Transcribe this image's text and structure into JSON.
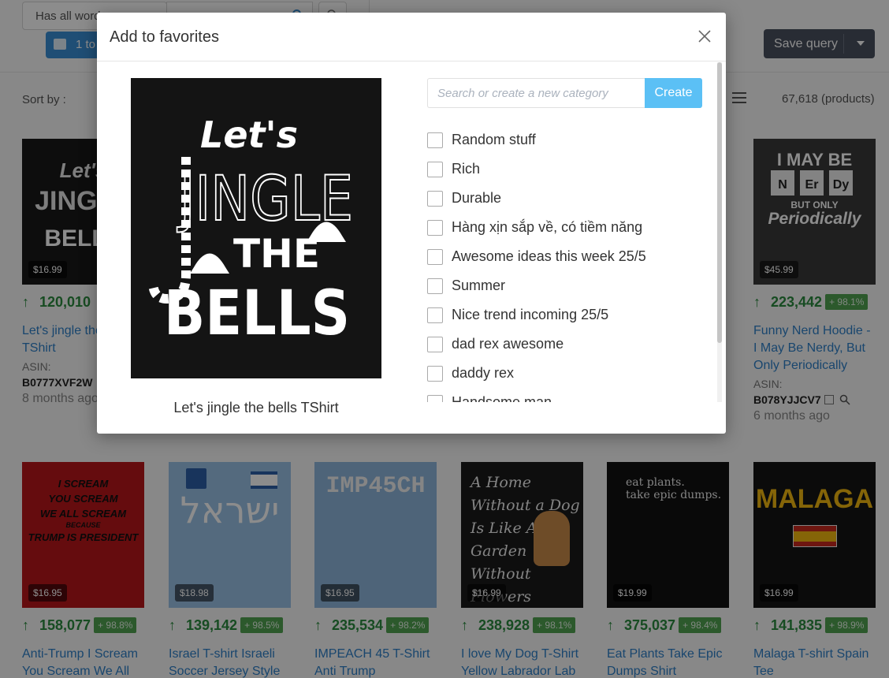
{
  "toolbar": {
    "filter_mode": "Has all words",
    "results_label": "1 to",
    "save_query_label": "Save query"
  },
  "listing": {
    "sort_label": "Sort by :",
    "product_count": "67,618 (products)"
  },
  "products_top": [
    {
      "price": "$16.99",
      "rank": "120,010",
      "title": "Let's jingle the bells TShirt",
      "asin_label": "ASIN:",
      "asin": "B0777XVF2W",
      "age": "8 months ago"
    },
    {
      "price": "$45.99",
      "rank": "223,442",
      "pct": "+ 98.1%",
      "title": "Funny Nerd Hoodie - I May Be Nerdy, But Only Periodically",
      "asin_label": "ASIN:",
      "asin": "B078YJJCV7",
      "age": "6 months ago"
    }
  ],
  "products_bottom": [
    {
      "price": "$16.95",
      "rank": "158,077",
      "pct": "+ 98.8%",
      "title": "Anti-Trump I Scream You Scream We All"
    },
    {
      "price": "$18.98",
      "rank": "139,142",
      "pct": "+ 98.5%",
      "title": "Israel T-shirt Israeli Soccer Jersey Style"
    },
    {
      "price": "$16.95",
      "rank": "235,534",
      "pct": "+ 98.2%",
      "title": "IMPEACH 45 T-Shirt Anti Trump"
    },
    {
      "price": "$16.99",
      "rank": "238,928",
      "pct": "+ 98.1%",
      "title": "I love My Dog T-Shirt Yellow Labrador Lab"
    },
    {
      "price": "$19.99",
      "rank": "375,037",
      "pct": "+ 98.4%",
      "title": "Eat Plants Take Epic Dumps Shirt"
    },
    {
      "price": "$16.99",
      "rank": "141,835",
      "pct": "+ 98.9%",
      "title": "Malaga T-shirt Spain Tee"
    }
  ],
  "thumb_art": {
    "nerd": {
      "line1": "I MAY BE",
      "line3": "BUT ONLY",
      "line4": "Periodically"
    },
    "scream": {
      "l1": "I SCREAM",
      "l2": "YOU SCREAM",
      "l3": "WE ALL SCREAM",
      "l4": "BECAUSE",
      "l5": "TRUMP IS PRESIDENT"
    },
    "israel": "ישראל",
    "impeach": "IMP45CH",
    "dog": {
      "l1": "A Home",
      "l2": "Without a Dog",
      "l3": "Is Like A",
      "l4": "Garden",
      "l5": "Without Flowers"
    },
    "plants": {
      "l1": "eat plants.",
      "l2": "take epic dumps."
    },
    "malaga": "MALAGA"
  },
  "modal": {
    "title": "Add to favorites",
    "product_caption": "Let's jingle the bells TShirt",
    "image_text": {
      "lets": "Let's",
      "jingle": "JINGLE",
      "the": "THE",
      "bells": "BELLS"
    },
    "search_placeholder": "Search or create a new category",
    "create_label": "Create",
    "categories": [
      "Random stuff",
      "Rich",
      "Durable",
      "Hàng xịn sắp về, có tiềm năng",
      "Awesome ideas this week 25/5",
      "Summer",
      "Nice trend incoming 25/5",
      "dad rex awesome",
      "daddy rex",
      "Handsome man"
    ]
  },
  "colors": {
    "overlay": "rgba(0,0,0,0.45)",
    "create_button": "#5bc0f5",
    "link": "#2f80c9",
    "rank_green": "#2b8a3e",
    "save_query": "#4a5160"
  }
}
